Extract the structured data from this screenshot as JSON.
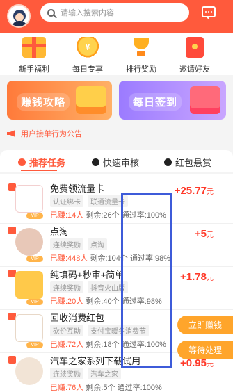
{
  "header": {
    "search_placeholder": "请输入搜索内容"
  },
  "shortcuts": [
    {
      "label": "新手福利",
      "icon": "gift-icon"
    },
    {
      "label": "每日专享",
      "icon": "coin-icon"
    },
    {
      "label": "排行奖励",
      "icon": "trophy-icon"
    },
    {
      "label": "邀请好友",
      "icon": "red-envelope-icon"
    }
  ],
  "banners": [
    {
      "label": "赚钱攻略"
    },
    {
      "label": "每日签到"
    }
  ],
  "notice": "用户接单行为公告",
  "tabs": [
    {
      "label": "推荐任务",
      "active": true
    },
    {
      "label": "快速审核",
      "active": false
    },
    {
      "label": "红包悬赏",
      "active": false
    }
  ],
  "tasks": [
    {
      "title": "免费领流量卡",
      "tags": [
        "认证绑卡",
        "联通流量卡"
      ],
      "earned": "已赚:14人",
      "remaining": "剩余:26个",
      "pass_rate": "通过率:100%",
      "reward": "+25.77",
      "unit": "元",
      "thumb_color": "#ff3030"
    },
    {
      "title": "点淘",
      "tags": [
        "连续奖励",
        "点淘"
      ],
      "earned": "已赚:448人",
      "remaining": "剩余:104个",
      "pass_rate": "通过率:98%",
      "reward": "+5",
      "unit": "元",
      "thumb_color": "#e8c8b8"
    },
    {
      "title": "纯填码+秒审+简单",
      "tags": [
        "连续奖励",
        "抖音火山版"
      ],
      "earned": "已赚:20人",
      "remaining": "剩余:40个",
      "pass_rate": "通过率:98%",
      "reward": "+1.78",
      "unit": "元",
      "thumb_color": "#ffc94a"
    },
    {
      "title": "回收消费红包",
      "tags": [
        "砍价互助",
        "支付宝暖冬消费节"
      ],
      "earned": "已赚:72人",
      "remaining": "剩余:18个",
      "pass_rate": "通过率:100%",
      "reward": "",
      "unit": "",
      "thumb_color": "#b34a2a"
    },
    {
      "title": "汽车之家系列下载试用",
      "tags": [
        "连续奖励",
        "汽车之家"
      ],
      "earned": "已赚:76人",
      "remaining": "剩余:5个",
      "pass_rate": "通过率:100%",
      "reward": "+0.95",
      "unit": "元",
      "thumb_color": "#f2e4d6"
    }
  ],
  "float_buttons": {
    "earn_now": "立即赚钱",
    "pending": "等待处理"
  },
  "colors": {
    "brand": "#ff5a3c",
    "reward": "#ff3a2a",
    "float": "#ffa52b",
    "annotation_box": "#3d5bd9"
  }
}
